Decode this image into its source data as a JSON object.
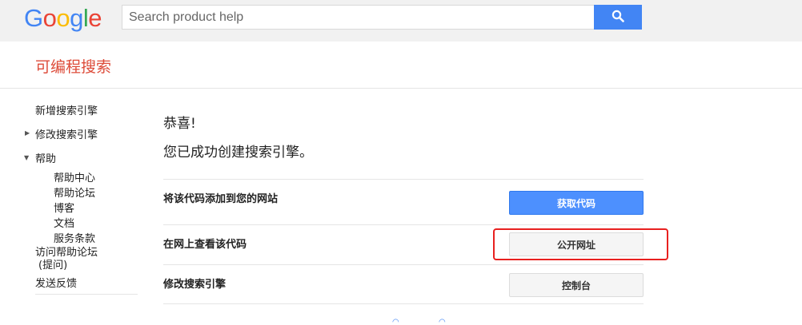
{
  "header": {
    "logo_letters": [
      {
        "char": "G",
        "color": "#4285f4"
      },
      {
        "char": "o",
        "color": "#ea4335"
      },
      {
        "char": "o",
        "color": "#fbbc05"
      },
      {
        "char": "g",
        "color": "#4285f4"
      },
      {
        "char": "l",
        "color": "#34a853"
      },
      {
        "char": "e",
        "color": "#ea4335"
      }
    ],
    "search_placeholder": "Search product help",
    "search_button_icon": "search-icon"
  },
  "product": {
    "title": "可编程搜索"
  },
  "sidebar": {
    "items": [
      {
        "label": "新增搜索引擎"
      },
      {
        "label": "修改搜索引擎",
        "collapsed": true
      },
      {
        "label": "帮助",
        "expanded": true
      },
      {
        "label": "帮助中心"
      },
      {
        "label": "帮助论坛"
      },
      {
        "label": "博客"
      },
      {
        "label": "文档"
      },
      {
        "label": "服务条款"
      },
      {
        "label": "访问帮助论坛"
      },
      {
        "label": "(提问)"
      },
      {
        "label": "发送反馈"
      }
    ]
  },
  "main": {
    "congrats": "恭喜!",
    "success_message": "您已成功创建搜索引擎。",
    "rows": [
      {
        "label": "将该代码添加到您的网站",
        "button": "获取代码",
        "style": "primary"
      },
      {
        "label": "在网上查看该代码",
        "button": "公开网址",
        "style": "default"
      },
      {
        "label": "修改搜索引擎",
        "button": "控制台",
        "style": "default"
      }
    ]
  },
  "colors": {
    "accent": "#4285f4",
    "brand_red": "#dd4b39",
    "primary_button": "#4d90fe",
    "highlight": "#e8201f"
  }
}
